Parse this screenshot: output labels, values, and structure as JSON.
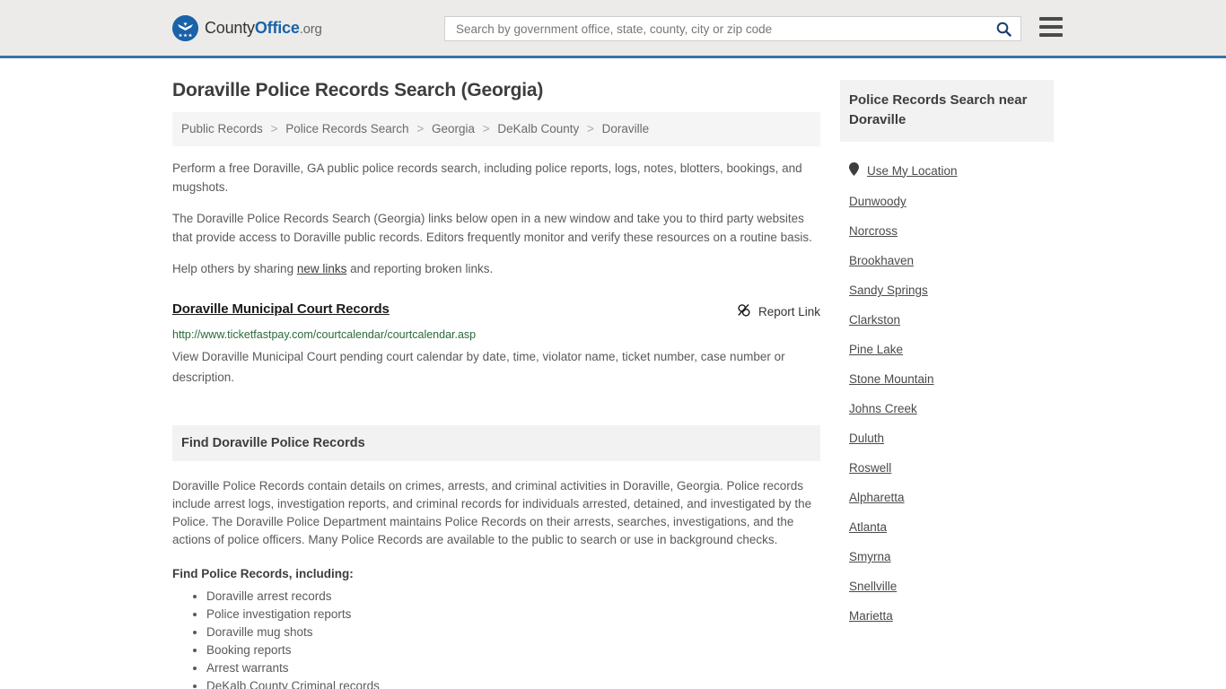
{
  "header": {
    "logo": {
      "part1": "County",
      "part2": "Office",
      "part3": ".org",
      "seal_icon": "eagle-seal-icon"
    },
    "search": {
      "placeholder": "Search by government office, state, county, city or zip code",
      "value": "",
      "search_icon": "search-icon"
    },
    "menu_icon": "hamburger-menu-icon"
  },
  "main": {
    "title": "Doraville Police Records Search (Georgia)",
    "breadcrumb": [
      "Public Records",
      "Police Records Search",
      "Georgia",
      "DeKalb County",
      "Doraville"
    ],
    "breadcrumb_separator": ">",
    "intro_paragraphs": [
      "Perform a free Doraville, GA public police records search, including police reports, logs, notes, blotters, bookings, and mugshots.",
      "The Doraville Police Records Search (Georgia) links below open in a new window and take you to third party websites that provide access to Doraville public records. Editors frequently monitor and verify these resources on a routine basis."
    ],
    "help_line": {
      "before": "Help others by sharing ",
      "link": "new links",
      "after": " and reporting broken links."
    },
    "result": {
      "title": "Doraville Municipal Court Records",
      "report_label": "Report Link",
      "report_icon": "broken-link-icon",
      "url": "http://www.ticketfastpay.com/courtcalendar/courtcalendar.asp",
      "description": "View Doraville Municipal Court pending court calendar by date, time, violator name, ticket number, case number or description."
    },
    "section": {
      "heading": "Find Doraville Police Records",
      "body": "Doraville Police Records contain details on crimes, arrests, and criminal activities in Doraville, Georgia. Police records include arrest logs, investigation reports, and criminal records for individuals arrested, detained, and investigated by the Police. The Doraville Police Department maintains Police Records on their arrests, searches, investigations, and the actions of police officers. Many Police Records are available to the public to search or use in background checks.",
      "sub_heading": "Find Police Records, including:",
      "items": [
        "Doraville arrest records",
        "Police investigation reports",
        "Doraville mug shots",
        "Booking reports",
        "Arrest warrants",
        "DeKalb County Criminal records"
      ]
    }
  },
  "sidebar": {
    "heading": "Police Records Search near Doraville",
    "location_item": {
      "label": "Use My Location",
      "icon": "map-pin-icon"
    },
    "cities": [
      "Dunwoody",
      "Norcross",
      "Brookhaven",
      "Sandy Springs",
      "Clarkston",
      "Pine Lake",
      "Stone Mountain",
      "Johns Creek",
      "Duluth",
      "Roswell",
      "Alpharetta",
      "Atlanta",
      "Smyrna",
      "Snellville",
      "Marietta"
    ]
  },
  "colors": {
    "header_bg": "#ecebe9",
    "header_border": "#3a74a8",
    "brand_blue": "#1a63a8",
    "url_green": "#2a6a3a",
    "panel_gray": "#f2f2f2"
  }
}
